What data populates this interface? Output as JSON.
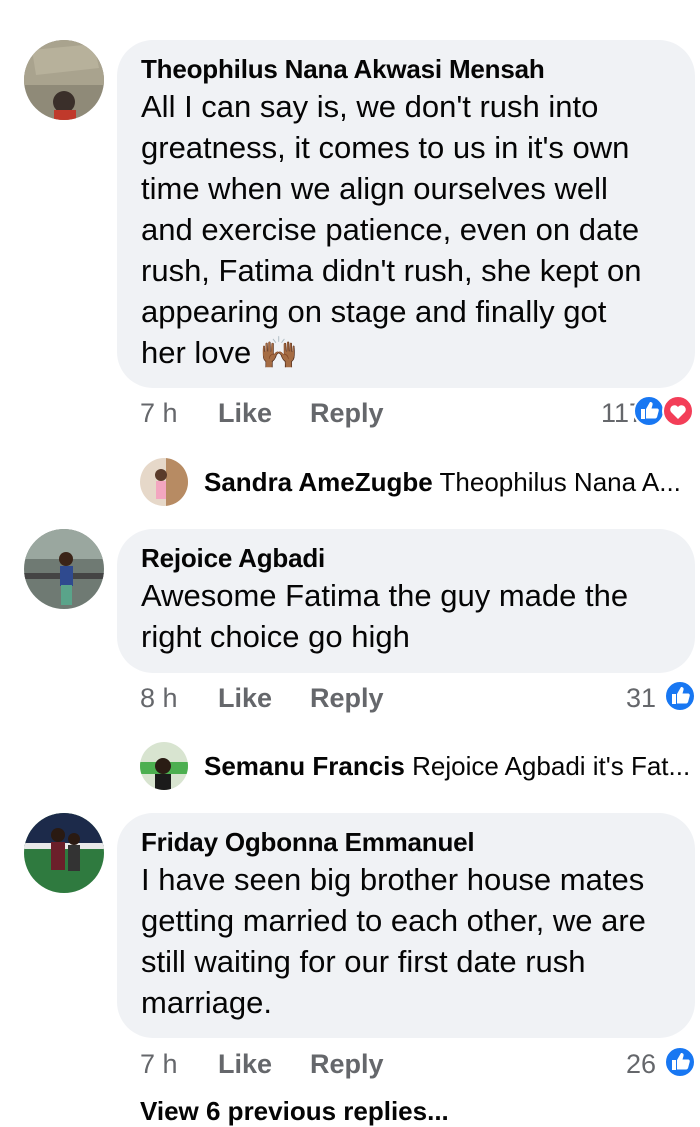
{
  "comments": [
    {
      "author": "Theophilus Nana Akwasi Mensah",
      "lines": [
        "All I can say is, we don't rush into",
        "greatness, it comes to us in it's own",
        "time when we align ourselves well",
        "and exercise patience, even on date",
        "rush, Fatima didn't rush, she kept on",
        "appearing on stage and finally got",
        "her love 🙌🏾"
      ],
      "time": "7 h",
      "like_label": "Like",
      "reply_label": "Reply",
      "reaction_count": "117",
      "reactions": [
        "like-icon",
        "love-icon"
      ],
      "reply": {
        "author": "Sandra AmeZugbe",
        "preview": "Theophilus Nana A..."
      }
    },
    {
      "author": "Rejoice Agbadi",
      "lines": [
        "Awesome Fatima the guy made the",
        "right choice go high"
      ],
      "time": "8 h",
      "like_label": "Like",
      "reply_label": "Reply",
      "reaction_count": "31",
      "reactions": [
        "like-icon"
      ],
      "reply": {
        "author": "Semanu Francis",
        "preview": "Rejoice Agbadi it's Fat..."
      }
    },
    {
      "author": "Friday Ogbonna Emmanuel",
      "lines": [
        "I have seen big brother house mates",
        "getting married to each other, we are",
        "still waiting for our first date rush",
        "marriage."
      ],
      "time": "7 h",
      "like_label": "Like",
      "reply_label": "Reply",
      "reaction_count": "26",
      "reactions": [
        "like-icon"
      ]
    }
  ],
  "view_more_label": "View 6 previous replies...",
  "colors": {
    "bubble": "#f0f2f5",
    "meta": "#65676b",
    "like_blue": "#1877f2",
    "love_red": "#f33e58"
  }
}
